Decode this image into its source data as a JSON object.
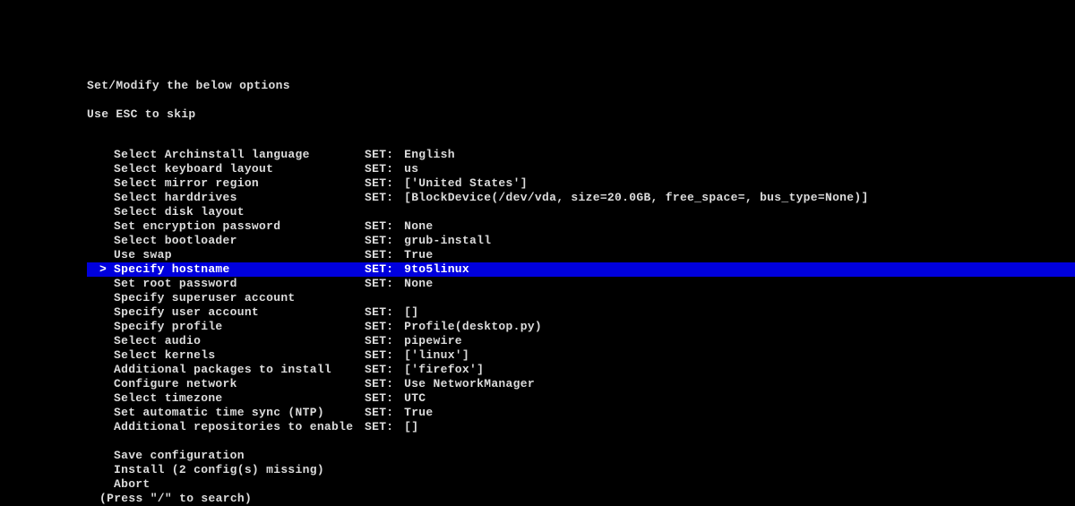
{
  "header": {
    "title": "Set/Modify the below options",
    "hint": "Use ESC to skip"
  },
  "cursor_marker": ">",
  "set_prefix": "SET:",
  "selected_index": 8,
  "menu": [
    {
      "label": "Select Archinstall language",
      "value": "English"
    },
    {
      "label": "Select keyboard layout",
      "value": "us"
    },
    {
      "label": "Select mirror region",
      "value": "['United States']"
    },
    {
      "label": "Select harddrives",
      "value": "[BlockDevice(/dev/vda, size=20.0GB, free_space=, bus_type=None)]"
    },
    {
      "label": "Select disk layout",
      "value": null
    },
    {
      "label": "Set encryption password",
      "value": "None"
    },
    {
      "label": "Select bootloader",
      "value": "grub-install"
    },
    {
      "label": "Use swap",
      "value": "True"
    },
    {
      "label": "Specify hostname",
      "value": "9to5linux"
    },
    {
      "label": "Set root password",
      "value": "None"
    },
    {
      "label": "Specify superuser account",
      "value": null
    },
    {
      "label": "Specify user account",
      "value": "[]"
    },
    {
      "label": "Specify profile",
      "value": "Profile(desktop.py)"
    },
    {
      "label": "Select audio",
      "value": "pipewire"
    },
    {
      "label": "Select kernels",
      "value": "['linux']"
    },
    {
      "label": "Additional packages to install",
      "value": "['firefox']"
    },
    {
      "label": "Configure network",
      "value": "Use NetworkManager"
    },
    {
      "label": "Select timezone",
      "value": "UTC"
    },
    {
      "label": "Set automatic time sync (NTP)",
      "value": "True"
    },
    {
      "label": "Additional repositories to enable",
      "value": "[]"
    }
  ],
  "actions": [
    {
      "label": "Save configuration"
    },
    {
      "label": "Install (2 config(s) missing)"
    },
    {
      "label": "Abort"
    }
  ],
  "footer": {
    "hint": "(Press \"/\" to search)"
  }
}
